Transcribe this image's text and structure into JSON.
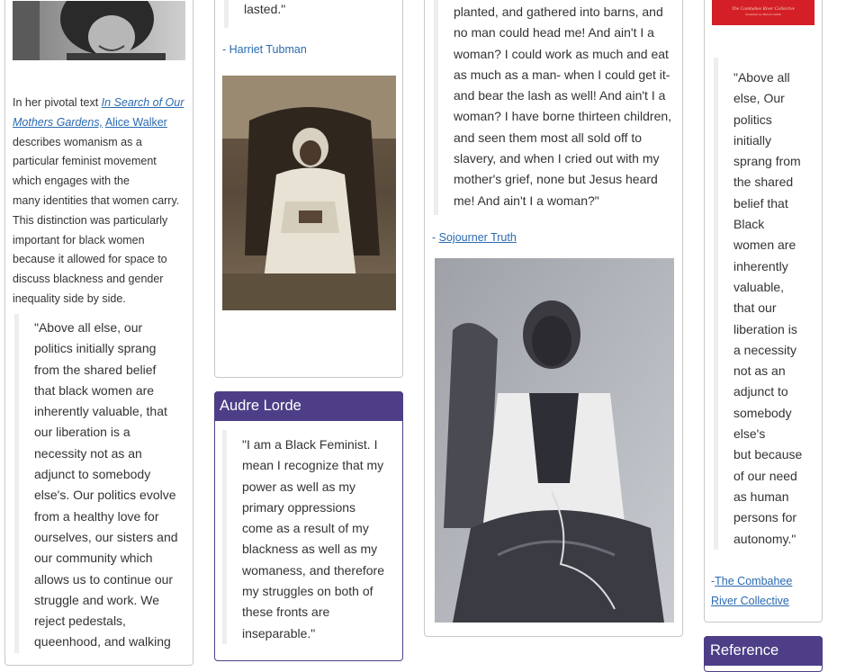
{
  "col1": {
    "intro_prefix": "In her pivotal text ",
    "book_title": "In Search of Our Mothers Gardens,",
    "author_link": "Alice Walker",
    "intro_line3": "describes womanism as a",
    "intro_line4": "particular feminist movement",
    "intro_line5": "which engages with the",
    "intro_line6": "many identities that women carry.",
    "intro_line7": "This distinction was particularly",
    "intro_line8": "important for black women",
    "intro_line9": "because it allowed for space to",
    "intro_line10": "discuss blackness and gender",
    "intro_line11": "inequality side by side.",
    "quote_lines": [
      "\"Above all else, our",
      "politics initially sprang",
      "from the shared belief",
      "that black women are",
      "inherently valuable, that",
      "our liberation is a",
      "necessity not as an",
      "adjunct to somebody",
      "else's. Our politics evolve",
      "from a healthy love for",
      "ourselves, our sisters and",
      "our community which",
      "allows us to continue our",
      "struggle and work. We",
      "reject pedestals,",
      "queenhood, and walking"
    ]
  },
  "col2": {
    "quote_end": "lasted.\"",
    "attribution": "- Harriet Tubman",
    "lorde_header": "Audre Lorde",
    "lorde_lines": [
      "\"I am a Black Feminist. I",
      "mean I recognize that my",
      "power as well as my",
      "primary oppressions",
      "come as a result of my",
      "blackness as well as my",
      "womaness, and therefore",
      "my struggles on both of",
      "these fronts are",
      "inseparable.\""
    ]
  },
  "col3": {
    "quote_lines": [
      "planted, and gathered into barns, and",
      "no man could head me! And ain't I a",
      "woman? I could work as much and eat",
      "as much as a man- when I could get it-",
      "and bear the lash as well! And ain't I a",
      "woman? I have borne thirteen children,",
      "and seen them most all sold off to",
      "slavery, and when I cried out with my",
      "mother's grief, none but Jesus heard",
      "me! And ain't I a woman?\""
    ],
    "attr_prefix": "- ",
    "attr_link": "Sojourner Truth "
  },
  "col4": {
    "book_cover_title": "The Combahee River Collective",
    "book_cover_sub": "Statement by Barbara Smith",
    "quote_lines": [
      "\"Above all",
      "else, Our",
      "politics",
      "initially",
      "sprang from",
      "the shared",
      "belief that",
      "Black",
      "women are",
      "inherently",
      "valuable,",
      "that our",
      "liberation is",
      "a necessity",
      "not as an",
      "adjunct to",
      "somebody",
      "else's",
      "but because",
      "of our need",
      "as human",
      "persons for",
      "autonomy.\""
    ],
    "attr_prefix": "-",
    "attr_link_1": "The Combahee",
    "attr_link_2": "River Collective",
    "reference_header": "Reference"
  },
  "colors": {
    "header_purple": "#4e3e87",
    "link_blue": "#2a6ab0",
    "book_red": "#d41f26"
  }
}
